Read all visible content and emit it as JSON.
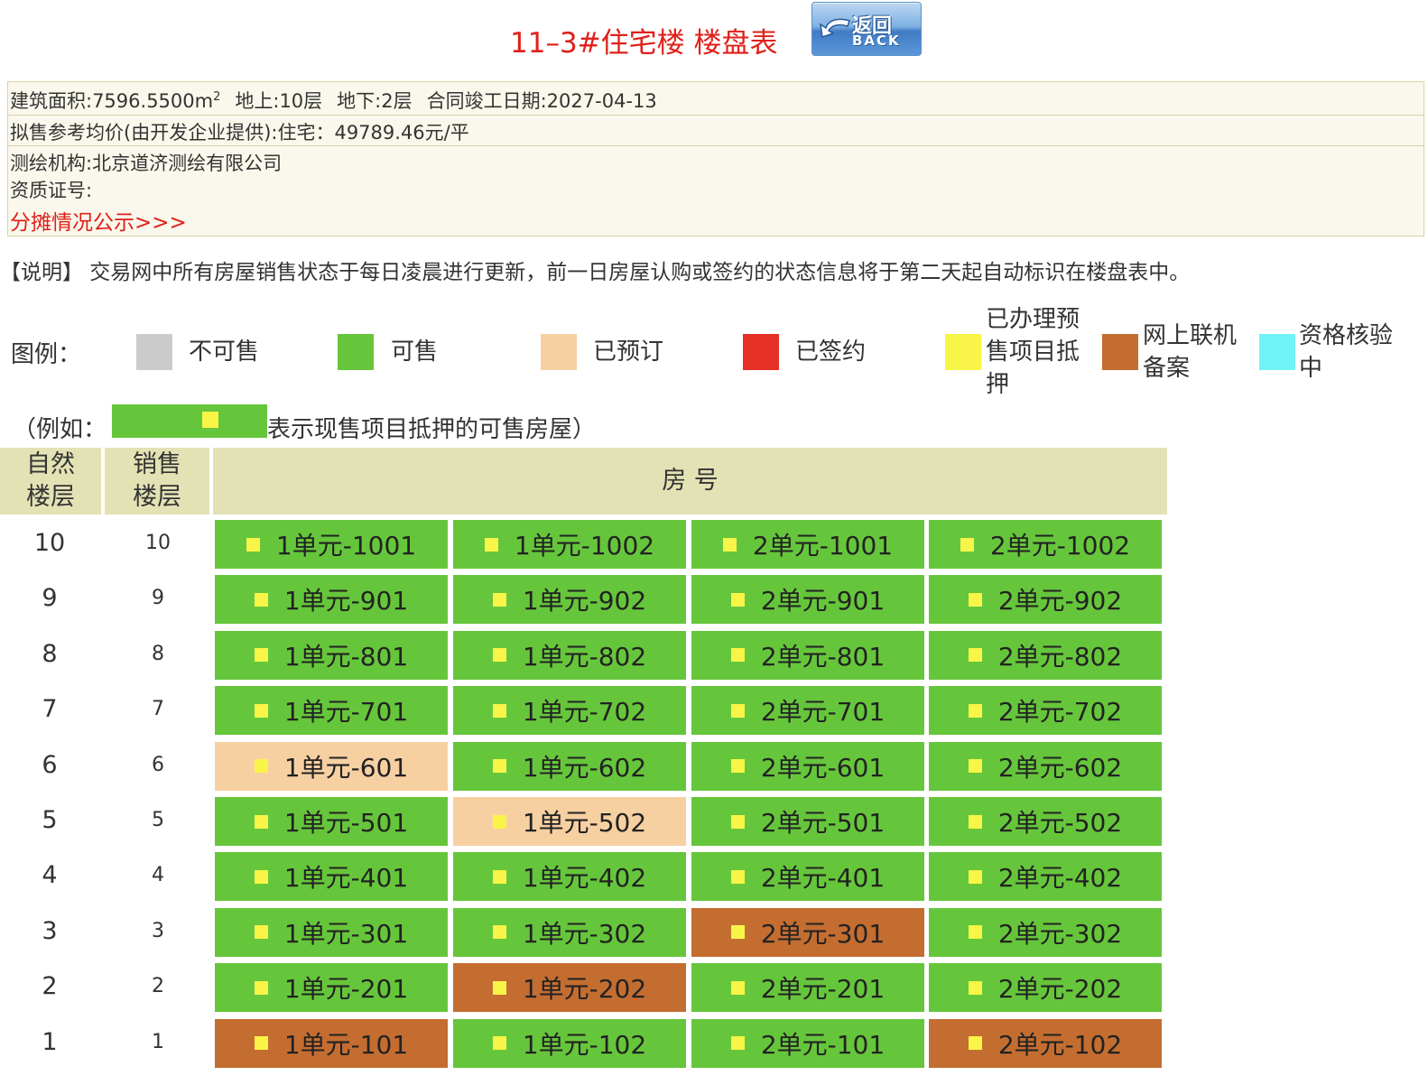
{
  "header": {
    "title": "11–3#住宅楼 楼盘表",
    "back_cn": "返回",
    "back_en": "BACK"
  },
  "info": {
    "area_label": "建筑面积:7596.5500m",
    "area_sup": "2",
    "above_ground": "地上:10层",
    "below_ground": "地下:2层",
    "completion": "合同竣工日期:2027-04-13",
    "price": "拟售参考均价(由开发企业提供):住宅：49789.46元/平",
    "survey_org": "测绘机构:北京道济测绘有限公司",
    "cert_no": "资质证号:",
    "allocation_link": "分摊情况公示>>>"
  },
  "notice": "【说明】 交易网中所有房屋销售状态于每日凌晨进行更新，前一日房屋认购或签约的状态信息将于第二天起自动标识在楼盘表中。",
  "legend": {
    "label": "图例：",
    "items": [
      {
        "label": "不可售",
        "color": "#cccccc"
      },
      {
        "label": "可售",
        "color": "#66c63b"
      },
      {
        "label": "已预订",
        "color": "#f7d0a2"
      },
      {
        "label": "已签约",
        "color": "#e53025"
      },
      {
        "label": "已办理预售项目抵押",
        "color": "#f8f548"
      },
      {
        "label": "网上联机备案",
        "color": "#c46d31"
      },
      {
        "label": "资格核验中",
        "color": "#72f3f8"
      }
    ]
  },
  "example": {
    "before": "（例如：",
    "after": "表示现售项目抵押的可售房屋）"
  },
  "table": {
    "col_natural": "自然楼层",
    "col_sales": "销售楼层",
    "col_room": "房 号",
    "rows": [
      {
        "floor": "10",
        "sale": "10",
        "units": [
          {
            "label": "1单元-1001",
            "status": "green"
          },
          {
            "label": "1单元-1002",
            "status": "green"
          },
          {
            "label": "2单元-1001",
            "status": "green"
          },
          {
            "label": "2单元-1002",
            "status": "green"
          }
        ]
      },
      {
        "floor": "9",
        "sale": "9",
        "units": [
          {
            "label": "1单元-901",
            "status": "green"
          },
          {
            "label": "1单元-902",
            "status": "green"
          },
          {
            "label": "2单元-901",
            "status": "green"
          },
          {
            "label": "2单元-902",
            "status": "green"
          }
        ]
      },
      {
        "floor": "8",
        "sale": "8",
        "units": [
          {
            "label": "1单元-801",
            "status": "green"
          },
          {
            "label": "1单元-802",
            "status": "green"
          },
          {
            "label": "2单元-801",
            "status": "green"
          },
          {
            "label": "2单元-802",
            "status": "green"
          }
        ]
      },
      {
        "floor": "7",
        "sale": "7",
        "units": [
          {
            "label": "1单元-701",
            "status": "green"
          },
          {
            "label": "1单元-702",
            "status": "green"
          },
          {
            "label": "2单元-701",
            "status": "green"
          },
          {
            "label": "2单元-702",
            "status": "green"
          }
        ]
      },
      {
        "floor": "6",
        "sale": "6",
        "units": [
          {
            "label": "1单元-601",
            "status": "peach"
          },
          {
            "label": "1单元-602",
            "status": "green"
          },
          {
            "label": "2单元-601",
            "status": "green"
          },
          {
            "label": "2单元-602",
            "status": "green"
          }
        ]
      },
      {
        "floor": "5",
        "sale": "5",
        "units": [
          {
            "label": "1单元-501",
            "status": "green"
          },
          {
            "label": "1单元-502",
            "status": "peach"
          },
          {
            "label": "2单元-501",
            "status": "green"
          },
          {
            "label": "2单元-502",
            "status": "green"
          }
        ]
      },
      {
        "floor": "4",
        "sale": "4",
        "units": [
          {
            "label": "1单元-401",
            "status": "green"
          },
          {
            "label": "1单元-402",
            "status": "green"
          },
          {
            "label": "2单元-401",
            "status": "green"
          },
          {
            "label": "2单元-402",
            "status": "green"
          }
        ]
      },
      {
        "floor": "3",
        "sale": "3",
        "units": [
          {
            "label": "1单元-301",
            "status": "green"
          },
          {
            "label": "1单元-302",
            "status": "green"
          },
          {
            "label": "2单元-301",
            "status": "brown"
          },
          {
            "label": "2单元-302",
            "status": "green"
          }
        ]
      },
      {
        "floor": "2",
        "sale": "2",
        "units": [
          {
            "label": "1单元-201",
            "status": "green"
          },
          {
            "label": "1单元-202",
            "status": "brown"
          },
          {
            "label": "2单元-201",
            "status": "green"
          },
          {
            "label": "2单元-202",
            "status": "green"
          }
        ]
      },
      {
        "floor": "1",
        "sale": "1",
        "units": [
          {
            "label": "1单元-101",
            "status": "brown"
          },
          {
            "label": "1单元-102",
            "status": "green"
          },
          {
            "label": "2单元-101",
            "status": "green"
          },
          {
            "label": "2单元-102",
            "status": "brown"
          }
        ]
      }
    ]
  },
  "status_colors": {
    "green": "#66c63b",
    "peach": "#f7d0a2",
    "brown": "#c46d31"
  }
}
